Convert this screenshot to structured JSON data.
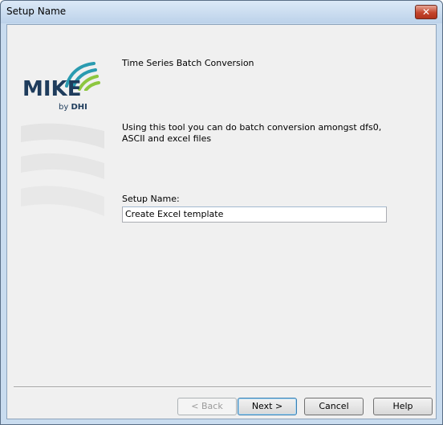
{
  "window": {
    "title": "Setup Name",
    "close_glyph": "✕"
  },
  "logo": {
    "word": "MIKE",
    "by": "by",
    "brand": "DHI",
    "colors": {
      "text": "#1e3c5c",
      "wave_teal": "#2a9bb0",
      "wave_green": "#8dc63f"
    }
  },
  "main": {
    "heading": "Time Series Batch Conversion",
    "description": "Using this tool you can do batch conversion amongst dfs0, ASCII and excel files",
    "field_label": "Setup Name:",
    "field_value": "Create Excel template"
  },
  "buttons": {
    "back": "< Back",
    "next": "Next >",
    "cancel": "Cancel",
    "help": "Help"
  }
}
